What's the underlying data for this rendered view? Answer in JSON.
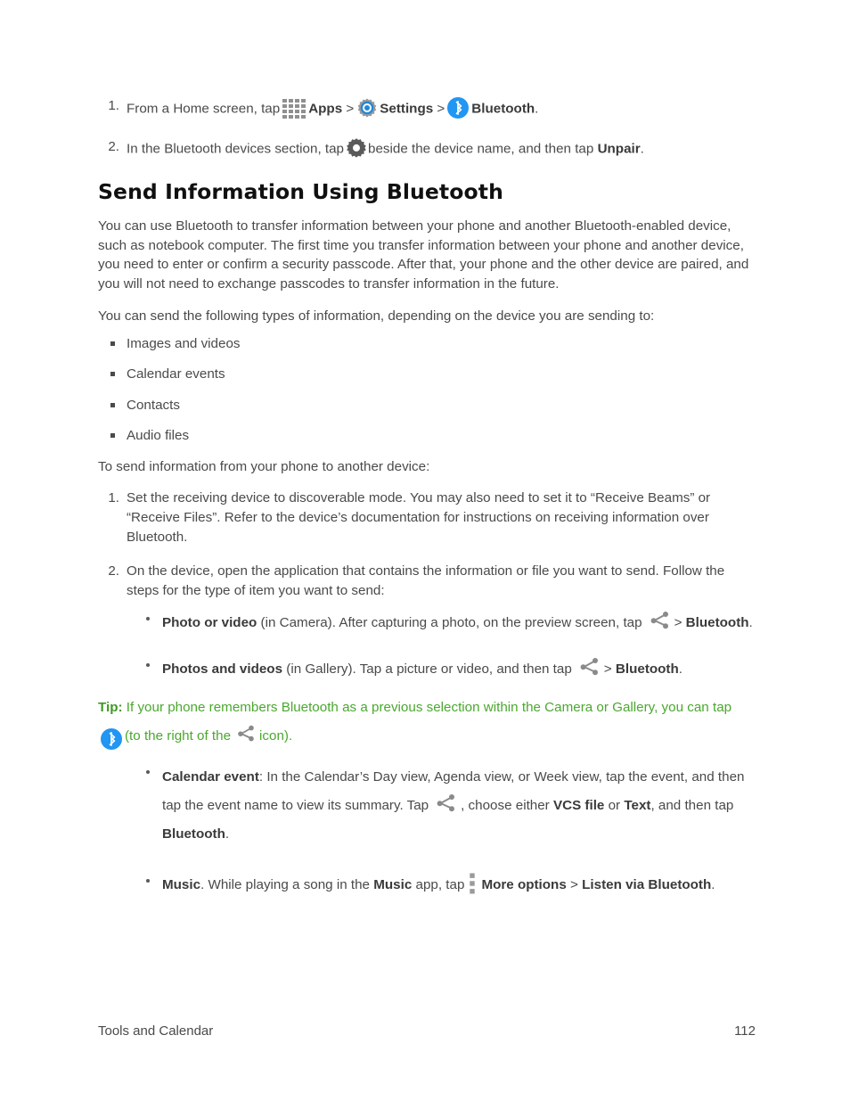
{
  "document": {
    "footer_left": "Tools and Calendar",
    "footer_page": "112"
  },
  "colors": {
    "body_text": "#4a4a4a",
    "heading": "#101010",
    "tip_green": "#4aa82e",
    "bluetooth_blue": "#2196F3",
    "icon_gray": "#8a8a8a"
  },
  "top_steps": [
    {
      "num": "1.",
      "part1": "From a Home screen, tap",
      "icon1": "apps-grid-icon",
      "bold1": "Apps",
      "sep1": ">",
      "icon2": "settings-gear-icon",
      "bold2": "Settings",
      "sep2": ">",
      "icon3": "bluetooth-icon",
      "bold3": "Bluetooth",
      "end": "."
    },
    {
      "num": "2.",
      "part1": "In the Bluetooth devices section, tap",
      "icon1": "gear-icon",
      "part2": "beside the device name, and then tap",
      "bold1": "Unpair",
      "end": "."
    }
  ],
  "heading": "Send Information Using Bluetooth",
  "intro_paragraph": "You can use Bluetooth to transfer information between your phone and another Bluetooth-enabled device, such as notebook computer. The first time you transfer information between your phone and another device, you need to enter or confirm a security passcode. After that, your phone and the other device are paired, and you will not need to exchange passcodes to transfer information in the future.",
  "types_intro": "You can send the following types of information, depending on the device you are sending to:",
  "types_list": [
    "Images and videos",
    "Calendar events",
    "Contacts",
    "Audio files"
  ],
  "send_intro": "To send information from your phone to another device:",
  "send_steps": [
    {
      "num": "1.",
      "text": "Set the receiving device to discoverable mode. You may also need to set it to “Receive Beams” or “Receive Files”. Refer to the device’s documentation for instructions on receiving information over Bluetooth."
    },
    {
      "num": "2.",
      "text": "On the device, open the application that contains the information or file you want to send. Follow the steps for the type of item you want to send:"
    }
  ],
  "sub_bullets": {
    "photo_or_video": {
      "bold_lead": "Photo or video",
      "text1": "(in Camera). After capturing a photo, on the preview screen, tap",
      "icon": "share-icon",
      "sep": ">",
      "bold_end": "Bluetooth",
      "end": "."
    },
    "photos_and_videos": {
      "bold_lead": "Photos and videos",
      "text1": "(in Gallery). Tap a picture or video, and then tap",
      "icon": "share-icon",
      "sep": ">",
      "bold_end": "Bluetooth",
      "end": "."
    },
    "calendar_event": {
      "bold_lead": "Calendar event",
      "text1": ": In the Calendar’s Day view, Agenda view, or Week view, tap the event,",
      "text2": "and then tap the event name to view its summary. Tap",
      "icon": "share-icon",
      "text3": ", choose either",
      "bold2": "VCS file",
      "text4": "or",
      "bold3": "Text",
      "text5": ", and then tap",
      "bold4": "Bluetooth",
      "end": "."
    },
    "music": {
      "bold_lead": "Music",
      "text1": ". While playing a song in the",
      "bold2": "Music",
      "text2": "app, tap",
      "icon": "more-options-icon",
      "bold3": "More options",
      "sep": ">",
      "bold4": "Listen via Bluetooth",
      "end": "."
    }
  },
  "tip": {
    "label": "Tip:",
    "text1": "If your phone remembers Bluetooth as a previous selection within the Camera or Gallery, you can tap",
    "icon1": "bluetooth-icon",
    "text2": "(to the right of the",
    "icon2": "share-icon",
    "text3": "icon)."
  }
}
